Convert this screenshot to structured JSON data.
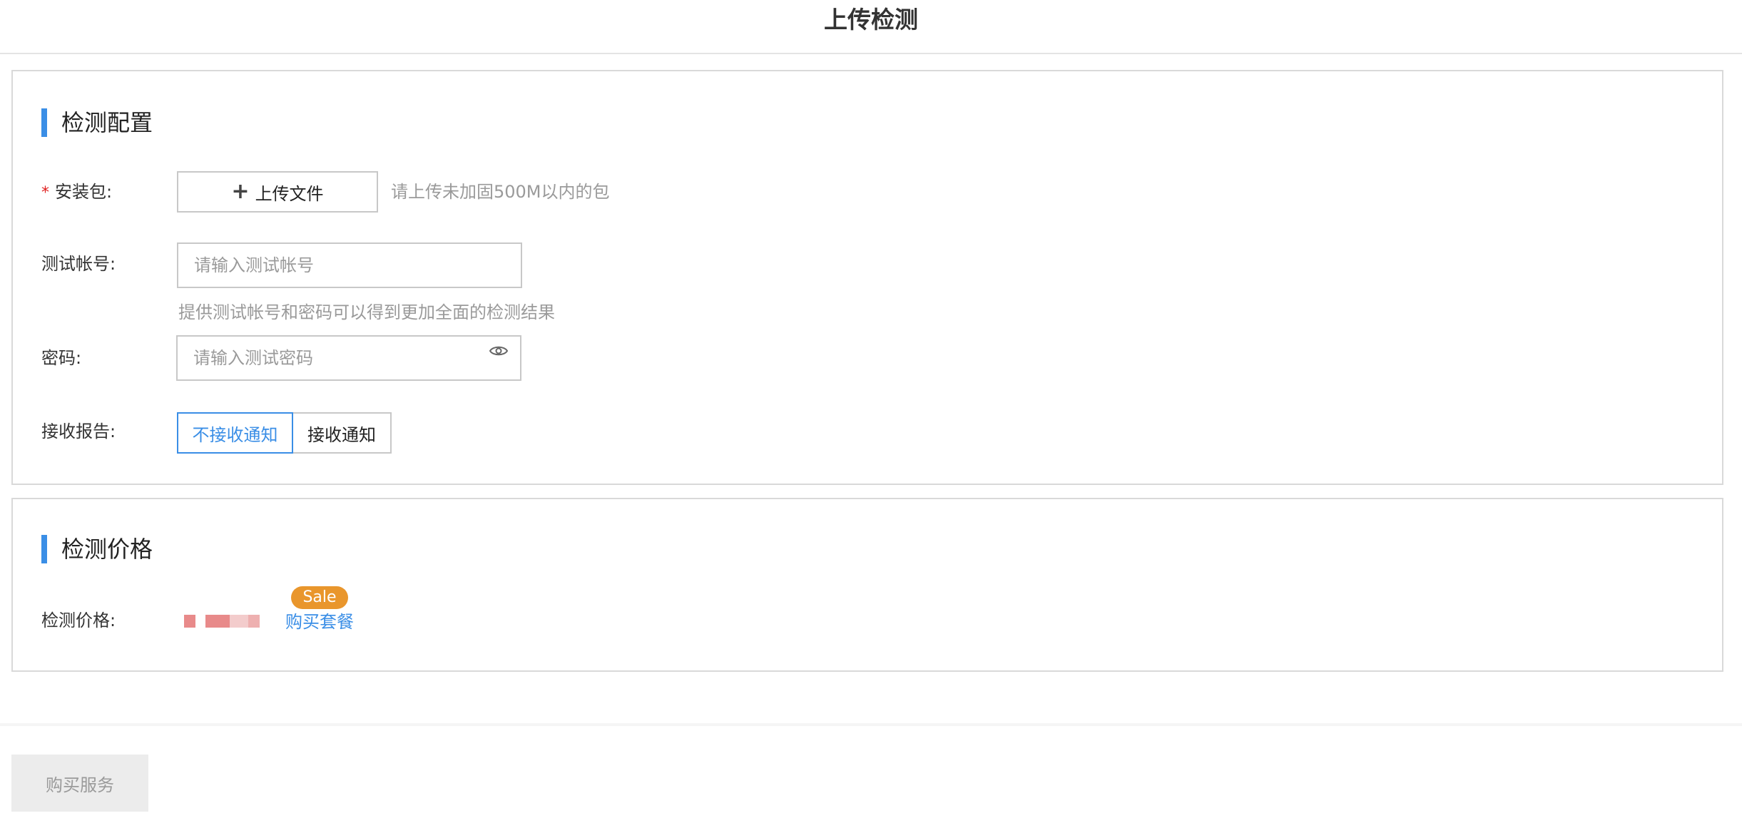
{
  "header": {
    "title": "上传检测"
  },
  "config": {
    "section_title": "检测配置",
    "package": {
      "required_mark": "*",
      "label": "安装包:",
      "upload_button": "上传文件",
      "hint": "请上传未加固500M以内的包"
    },
    "account": {
      "label": "测试帐号:",
      "placeholder": "请输入测试帐号",
      "hint": "提供测试帐号和密码可以得到更加全面的检测结果"
    },
    "password": {
      "label": "密码:",
      "placeholder": "请输入测试密码",
      "icon": "eye-icon"
    },
    "report": {
      "label": "接收报告:",
      "options": [
        "不接收通知",
        "接收通知"
      ],
      "selected": "不接收通知"
    }
  },
  "price": {
    "section_title": "检测价格",
    "label": "检测价格:",
    "badge": "Sale",
    "link": "购买套餐"
  },
  "footer": {
    "buy_button": "购买服务"
  },
  "colors": {
    "accent": "#3a8ee6",
    "required": "#e02020",
    "sale_badge": "#e9962c",
    "disabled_button_bg": "#ececec"
  }
}
